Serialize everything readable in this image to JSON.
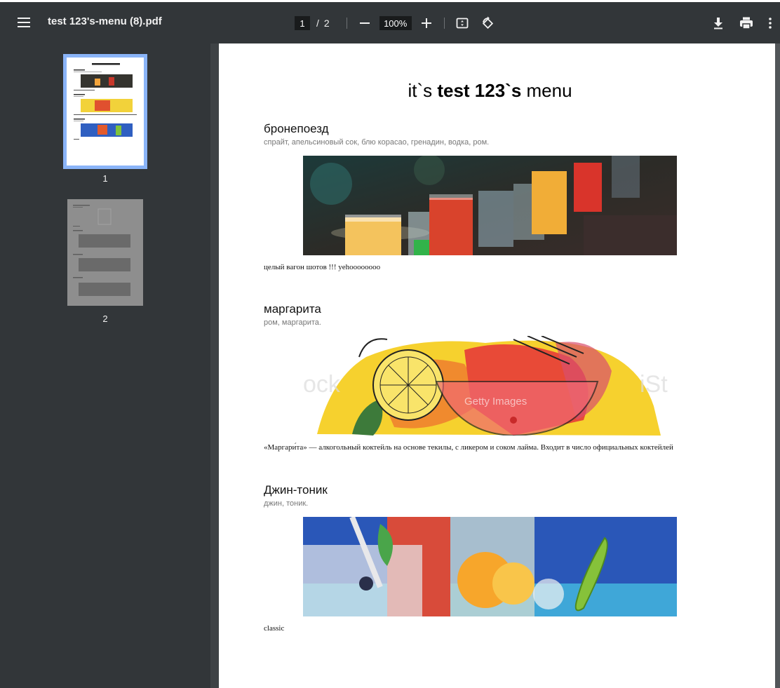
{
  "toolbar": {
    "title": "test 123's-menu (8).pdf",
    "current_page": "1",
    "page_separator": "/",
    "total_pages": "2",
    "zoom": "100%"
  },
  "thumbnails": [
    {
      "label": "1",
      "selected": true
    },
    {
      "label": "2",
      "selected": false
    }
  ],
  "document": {
    "title_prefix": "it`s ",
    "title_bold": "test 123`s",
    "title_suffix": " menu",
    "sections": [
      {
        "name": "бронепоезд",
        "ingredients": "спрайт, апельсиновый сок, блю корасао, гренадин, водка, ром.",
        "description": "целый вагон шотов !!! yehoooooooo"
      },
      {
        "name": "маргарита",
        "ingredients": "ром, маргарита.",
        "description": "«Маргари́та» — алкогольный коктейль на основе текилы, с ликером и соком лайма. Входит в число официальных коктейлей"
      },
      {
        "name": "Джин-тоник",
        "ingredients": "джин, тоник.",
        "description": "classic"
      }
    ],
    "watermark_text": "Getty Images"
  },
  "icons": {
    "menu": "menu-icon",
    "zoom_out": "minus-icon",
    "zoom_in": "plus-icon",
    "fit": "fit-page-icon",
    "rotate": "rotate-icon",
    "download": "download-icon",
    "print": "print-icon",
    "more": "more-vert-icon"
  }
}
